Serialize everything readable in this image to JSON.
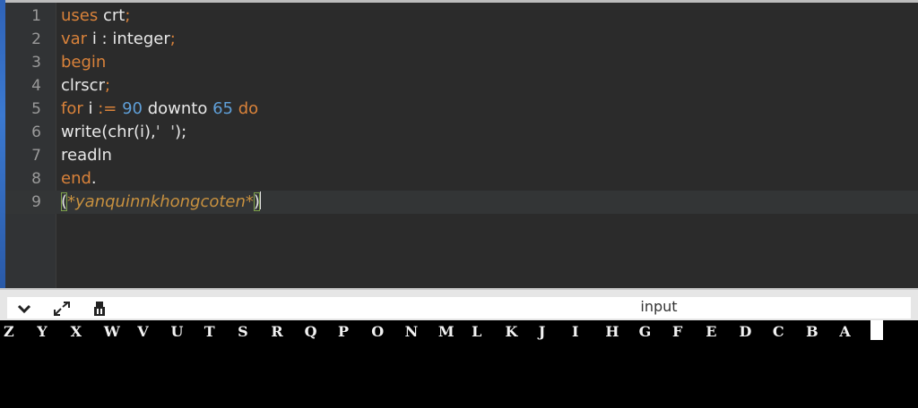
{
  "editor": {
    "lines": [
      {
        "num": "1",
        "tokens": [
          {
            "t": "uses",
            "c": "kw"
          },
          {
            "t": " crt",
            "c": ""
          },
          {
            "t": ";",
            "c": "kw"
          }
        ]
      },
      {
        "num": "2",
        "tokens": [
          {
            "t": "var",
            "c": "kw"
          },
          {
            "t": " i : integer",
            "c": ""
          },
          {
            "t": ";",
            "c": "kw"
          }
        ]
      },
      {
        "num": "3",
        "tokens": [
          {
            "t": "begin",
            "c": "kw"
          }
        ]
      },
      {
        "num": "4",
        "tokens": [
          {
            "t": "clrscr",
            "c": ""
          },
          {
            "t": ";",
            "c": "kw"
          }
        ]
      },
      {
        "num": "5",
        "tokens": [
          {
            "t": "for",
            "c": "kw"
          },
          {
            "t": " i ",
            "c": ""
          },
          {
            "t": ":=",
            "c": "kw"
          },
          {
            "t": " ",
            "c": ""
          },
          {
            "t": "90",
            "c": "num"
          },
          {
            "t": " downto ",
            "c": ""
          },
          {
            "t": "65",
            "c": "num"
          },
          {
            "t": " ",
            "c": ""
          },
          {
            "t": "do",
            "c": "kw"
          }
        ]
      },
      {
        "num": "6",
        "tokens": [
          {
            "t": "write(chr(i),",
            "c": ""
          },
          {
            "t": "'  '",
            "c": "str"
          },
          {
            "t": ");",
            "c": ""
          }
        ]
      },
      {
        "num": "7",
        "tokens": [
          {
            "t": "readln",
            "c": ""
          }
        ]
      },
      {
        "num": "8",
        "tokens": [
          {
            "t": "end",
            "c": "kw"
          },
          {
            "t": ".",
            "c": ""
          }
        ]
      },
      {
        "num": "9",
        "tokens": [
          {
            "t": "(",
            "c": "paren"
          },
          {
            "t": "*yanquinnkhongcoten*",
            "c": "cmt"
          },
          {
            "t": ")",
            "c": "paren"
          }
        ],
        "active": true
      }
    ]
  },
  "toolbar": {
    "collapse_icon": "chevron-down-icon",
    "expand_icon": "expand-arrows-icon",
    "clear_icon": "clear-console-icon",
    "input_label": "input"
  },
  "console": {
    "output": [
      "Z",
      "Y",
      "X",
      "W",
      "V",
      "U",
      "T",
      "S",
      "R",
      "Q",
      "P",
      "O",
      "N",
      "M",
      "L",
      "K",
      "J",
      "I",
      "H",
      "G",
      "F",
      "E",
      "D",
      "C",
      "B",
      "A"
    ]
  }
}
